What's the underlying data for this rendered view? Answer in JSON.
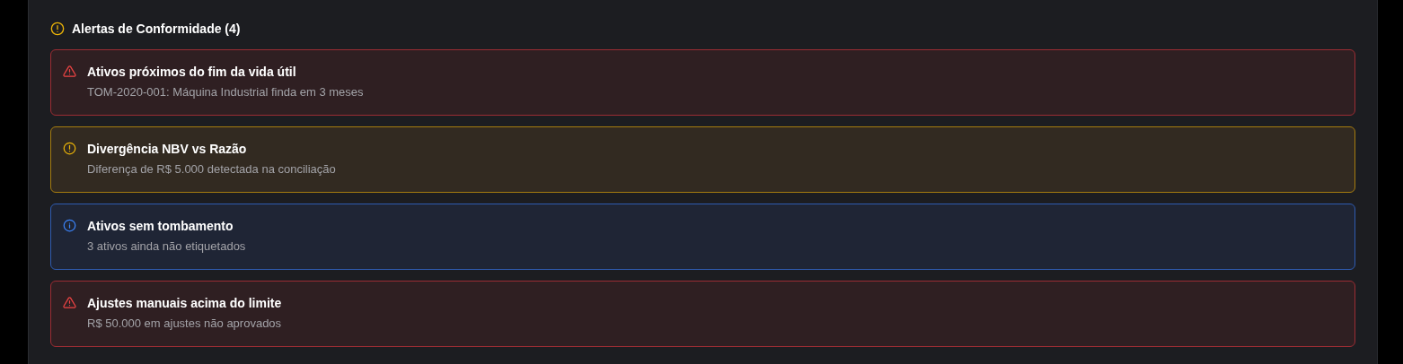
{
  "section": {
    "title": "Alertas de Conformidade (4)"
  },
  "alerts": [
    {
      "kind": "error",
      "title": "Ativos próximos do fim da vida útil",
      "description": "TOM-2020-001: Máquina Industrial finda em 3 meses"
    },
    {
      "kind": "warning",
      "title": "Divergência NBV vs Razão",
      "description": "Diferença de R$ 5.000 detectada na conciliação"
    },
    {
      "kind": "info",
      "title": "Ativos sem tombamento",
      "description": "3 ativos ainda não etiquetados"
    },
    {
      "kind": "error",
      "title": "Ajustes manuais acima do limite",
      "description": "R$ 50.000 em ajustes não aprovados"
    }
  ]
}
